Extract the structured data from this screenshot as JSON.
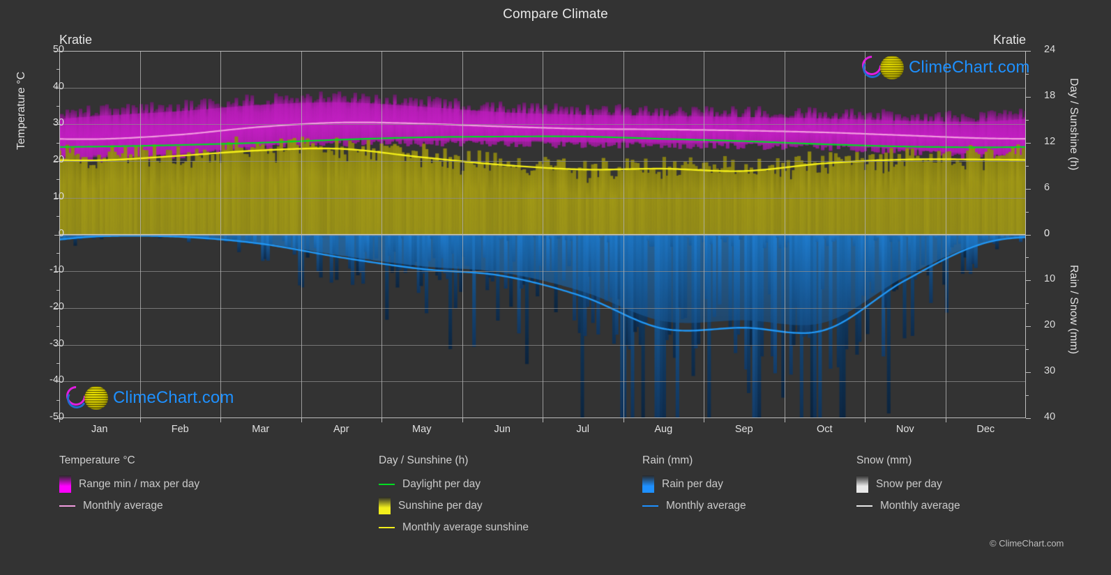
{
  "header": {
    "title": "Compare Climate",
    "location_left": "Kratie",
    "location_right": "Kratie"
  },
  "branding": {
    "logo_text": "ClimeChart.com",
    "copyright": "© ClimeChart.com",
    "logo_arc_color": "#e01ee0",
    "logo_ball_color": "#d4c800",
    "logo_text_color": "#1e90ff"
  },
  "axes": {
    "left_label": "Temperature °C",
    "left_ticks": [
      "50",
      "40",
      "30",
      "20",
      "10",
      "0",
      "-10",
      "-20",
      "-30",
      "-40",
      "-50"
    ],
    "right_top_label": "Day / Sunshine (h)",
    "right_top_ticks": [
      "24",
      "18",
      "12",
      "6",
      "0"
    ],
    "right_bottom_label": "Rain / Snow (mm)",
    "right_bottom_ticks": [
      "0",
      "10",
      "20",
      "30",
      "40"
    ],
    "x_ticks": [
      "Jan",
      "Feb",
      "Mar",
      "Apr",
      "May",
      "Jun",
      "Jul",
      "Aug",
      "Sep",
      "Oct",
      "Nov",
      "Dec"
    ]
  },
  "legend": {
    "groups": [
      {
        "title": "Temperature °C",
        "items": [
          {
            "label": "Range min / max per day",
            "marker": "gradient-box",
            "color": "#ff00ff"
          },
          {
            "label": "Monthly average",
            "marker": "line",
            "color": "#f29ce0"
          }
        ]
      },
      {
        "title": "Day / Sunshine (h)",
        "items": [
          {
            "label": "Daylight per day",
            "marker": "line",
            "color": "#00dd22"
          },
          {
            "label": "Sunshine per day",
            "marker": "gradient-box",
            "color": "#f2ee1c"
          },
          {
            "label": "Monthly average sunshine",
            "marker": "line",
            "color": "#f2ee1c"
          }
        ]
      },
      {
        "title": "Rain (mm)",
        "items": [
          {
            "label": "Rain per day",
            "marker": "gradient-box",
            "color": "#1e90ff"
          },
          {
            "label": "Monthly average",
            "marker": "line",
            "color": "#1e90ff"
          }
        ]
      },
      {
        "title": "Snow (mm)",
        "items": [
          {
            "label": "Snow per day",
            "marker": "gradient-box",
            "color": "#e8e8e8"
          },
          {
            "label": "Monthly average",
            "marker": "line",
            "color": "#e8e8e8"
          }
        ]
      }
    ]
  },
  "chart_data": {
    "type": "area",
    "title": "Compare Climate",
    "subtitle": "Kratie",
    "xlabel": "",
    "ylabel": "Temperature °C",
    "categories": [
      "Jan",
      "Feb",
      "Mar",
      "Apr",
      "May",
      "Jun",
      "Jul",
      "Aug",
      "Sep",
      "Oct",
      "Nov",
      "Dec"
    ],
    "ylim_temperature_c": [
      -50,
      50
    ],
    "ylim_day_sunshine_h": [
      0,
      24
    ],
    "ylim_rain_snow_mm": [
      0,
      40
    ],
    "grid": true,
    "legend_position": "below",
    "series": [
      {
        "name": "Temperature monthly average",
        "unit": "°C",
        "axis": "left",
        "color": "#f29ce0",
        "values": [
          26.0,
          27.2,
          29.3,
          30.5,
          30.2,
          29.4,
          28.8,
          28.6,
          28.3,
          27.8,
          27.0,
          26.2
        ]
      },
      {
        "name": "Temperature daily max (band top)",
        "unit": "°C",
        "axis": "left",
        "color": "#ff00ff",
        "values": [
          33.5,
          34.8,
          36.5,
          37.2,
          36.0,
          34.5,
          33.8,
          33.5,
          33.2,
          32.8,
          32.2,
          32.0
        ]
      },
      {
        "name": "Temperature daily min (band bottom)",
        "unit": "°C",
        "axis": "left",
        "color": "#ff00ff",
        "values": [
          20.5,
          21.5,
          23.5,
          25.0,
          25.0,
          24.8,
          24.5,
          24.4,
          24.2,
          23.8,
          22.6,
          21.2
        ]
      },
      {
        "name": "Daylight per day",
        "unit": "h",
        "axis": "right-top",
        "color": "#00dd22",
        "values": [
          11.5,
          11.7,
          12.0,
          12.4,
          12.7,
          12.8,
          12.8,
          12.5,
          12.2,
          11.8,
          11.5,
          11.4
        ]
      },
      {
        "name": "Monthly average sunshine",
        "unit": "h",
        "axis": "right-top",
        "color": "#f2ee1c",
        "values": [
          9.7,
          10.3,
          11.0,
          11.2,
          10.1,
          9.1,
          8.5,
          8.6,
          8.3,
          9.3,
          9.8,
          9.8
        ]
      },
      {
        "name": "Rain monthly average",
        "unit": "mm",
        "axis": "right-bottom",
        "color": "#1e90ff",
        "values": [
          0.4,
          0.5,
          2.0,
          5.0,
          7.5,
          9.0,
          13.5,
          20.5,
          20.3,
          20.8,
          10.0,
          1.8
        ]
      },
      {
        "name": "Snow monthly average",
        "unit": "mm",
        "axis": "right-bottom",
        "color": "#e8e8e8",
        "values": [
          0,
          0,
          0,
          0,
          0,
          0,
          0,
          0,
          0,
          0,
          0,
          0
        ]
      }
    ]
  }
}
